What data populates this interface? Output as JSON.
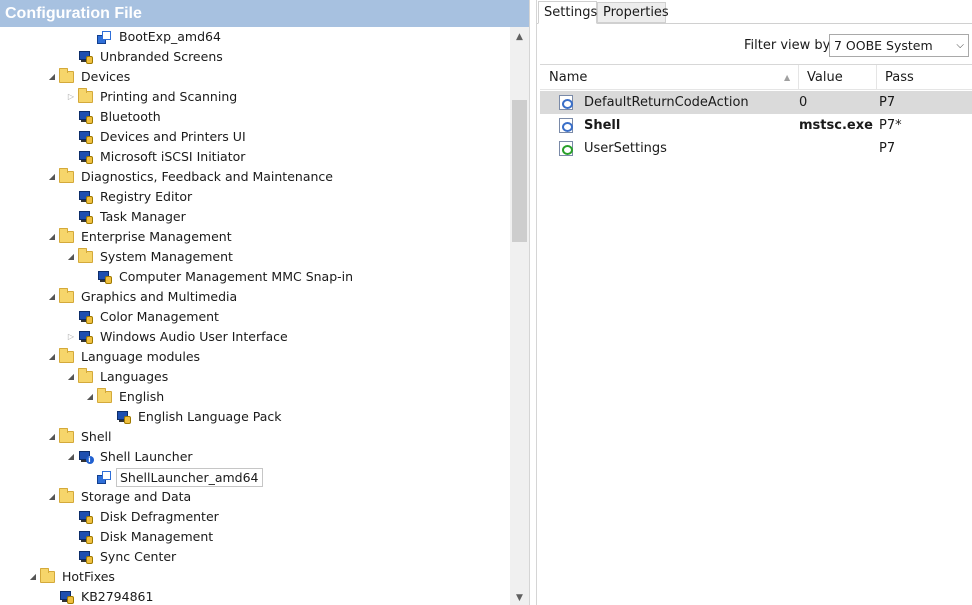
{
  "left_pane": {
    "title": "Configuration File",
    "tree": [
      {
        "label": "BootExp_amd64",
        "icon": "package-icon",
        "expander": "none",
        "level": 3
      },
      {
        "label": "Unbranded Screens",
        "icon": "component-icon",
        "expander": "none",
        "level": 2
      },
      {
        "label": "Devices",
        "icon": "folder-icon",
        "expander": "open",
        "level": 1
      },
      {
        "label": "Printing and Scanning",
        "icon": "folder-icon",
        "expander": "closed",
        "level": 2
      },
      {
        "label": "Bluetooth",
        "icon": "component-icon",
        "expander": "none",
        "level": 2
      },
      {
        "label": "Devices and Printers UI",
        "icon": "component-icon",
        "expander": "none",
        "level": 2
      },
      {
        "label": "Microsoft iSCSI Initiator",
        "icon": "component-icon",
        "expander": "none",
        "level": 2
      },
      {
        "label": "Diagnostics, Feedback and Maintenance",
        "icon": "folder-icon",
        "expander": "open",
        "level": 1
      },
      {
        "label": "Registry Editor",
        "icon": "component-icon",
        "expander": "none",
        "level": 2
      },
      {
        "label": "Task Manager",
        "icon": "component-icon",
        "expander": "none",
        "level": 2
      },
      {
        "label": "Enterprise Management",
        "icon": "folder-icon",
        "expander": "open",
        "level": 1
      },
      {
        "label": "System Management",
        "icon": "folder-icon",
        "expander": "open",
        "level": 2
      },
      {
        "label": "Computer Management MMC Snap-in",
        "icon": "component-icon",
        "expander": "none",
        "level": 3
      },
      {
        "label": "Graphics and Multimedia",
        "icon": "folder-icon",
        "expander": "open",
        "level": 1
      },
      {
        "label": "Color Management",
        "icon": "component-icon",
        "expander": "none",
        "level": 2
      },
      {
        "label": "Windows Audio User Interface",
        "icon": "component-icon",
        "expander": "closed",
        "level": 2
      },
      {
        "label": "Language modules",
        "icon": "folder-icon",
        "expander": "open",
        "level": 1
      },
      {
        "label": "Languages",
        "icon": "folder-icon",
        "expander": "open",
        "level": 2
      },
      {
        "label": "English",
        "icon": "folder-icon",
        "expander": "open",
        "level": 3
      },
      {
        "label": "English Language Pack",
        "icon": "component-icon",
        "expander": "none",
        "level": 4
      },
      {
        "label": "Shell",
        "icon": "folder-icon",
        "expander": "open",
        "level": 1
      },
      {
        "label": "Shell Launcher",
        "icon": "component-info-icon",
        "expander": "open",
        "level": 2
      },
      {
        "label": "ShellLauncher_amd64",
        "icon": "package-icon",
        "expander": "none",
        "level": 3,
        "selected": true
      },
      {
        "label": "Storage and Data",
        "icon": "folder-icon",
        "expander": "open",
        "level": 1
      },
      {
        "label": "Disk Defragmenter",
        "icon": "component-icon",
        "expander": "none",
        "level": 2
      },
      {
        "label": "Disk Management",
        "icon": "component-icon",
        "expander": "none",
        "level": 2
      },
      {
        "label": "Sync Center",
        "icon": "component-icon",
        "expander": "none",
        "level": 2
      },
      {
        "label": "HotFixes",
        "icon": "folder-icon",
        "expander": "open",
        "level": 0
      },
      {
        "label": "KB2794861",
        "icon": "component-icon",
        "expander": "none",
        "level": 1
      }
    ]
  },
  "right_pane": {
    "tabs": {
      "settings": "Settings",
      "properties": "Properties"
    },
    "filter": {
      "label": "Filter view by:",
      "selected": "7 OOBE System"
    },
    "columns": {
      "name": "Name",
      "value": "Value",
      "pass": "Pass"
    },
    "rows": [
      {
        "name": "DefaultReturnCodeAction",
        "value": "0",
        "pass": "P7",
        "bold": false,
        "selected": true,
        "icon": "setting-icon"
      },
      {
        "name": "Shell",
        "value": "mstsc.exe",
        "pass": "P7*",
        "bold": true,
        "selected": false,
        "icon": "setting-icon"
      },
      {
        "name": "UserSettings",
        "value": "",
        "pass": "P7",
        "bold": false,
        "selected": false,
        "icon": "setting-add-icon"
      }
    ]
  }
}
